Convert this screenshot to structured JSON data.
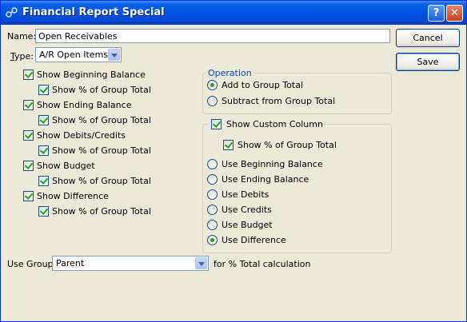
{
  "window": {
    "title": "Financial Report Special",
    "help_label": "?",
    "close_label": "✕"
  },
  "name": {
    "label": "Name:",
    "value": "Open Receivables"
  },
  "type": {
    "label": "Type:",
    "value": "A/R Open Items"
  },
  "buttons": {
    "cancel": "Cancel",
    "save": "Save"
  },
  "left_checks": [
    {
      "label": "Show Beginning Balance",
      "checked": true
    },
    {
      "label": "Show % of Group Total",
      "checked": true
    },
    {
      "label": "Show Ending Balance",
      "checked": true
    },
    {
      "label": "Show % of Group Total",
      "checked": true
    },
    {
      "label": "Show Debits/Credits",
      "checked": true
    },
    {
      "label": "Show % of Group Total",
      "checked": true
    },
    {
      "label": "Show Budget",
      "checked": true
    },
    {
      "label": "Show % of Group Total",
      "checked": true
    },
    {
      "label": "Show Difference",
      "checked": true
    },
    {
      "label": "Show % of Group Total",
      "checked": true
    }
  ],
  "operation": {
    "title": "Operation",
    "options": [
      {
        "label": "Add to Group Total",
        "selected": true
      },
      {
        "label": "Subtract from Group Total",
        "selected": false
      }
    ]
  },
  "custom": {
    "title": "Show Custom Column",
    "title_checked": true,
    "pct_label": "Show % of Group Total",
    "pct_checked": true,
    "options": [
      {
        "label": "Use Beginning Balance",
        "selected": false
      },
      {
        "label": "Use Ending Balance",
        "selected": false
      },
      {
        "label": "Use Debits",
        "selected": false
      },
      {
        "label": "Use Credits",
        "selected": false
      },
      {
        "label": "Use Budget",
        "selected": false
      },
      {
        "label": "Use Difference",
        "selected": true
      }
    ]
  },
  "use_group": {
    "label": "Use Group",
    "value": "Parent",
    "suffix": "for % Total calculation"
  },
  "colors": {
    "title_bar": "#0054e3",
    "window_bg": "#ece9d8",
    "group_title": "#0046d5",
    "check_mark": "#21a121"
  }
}
